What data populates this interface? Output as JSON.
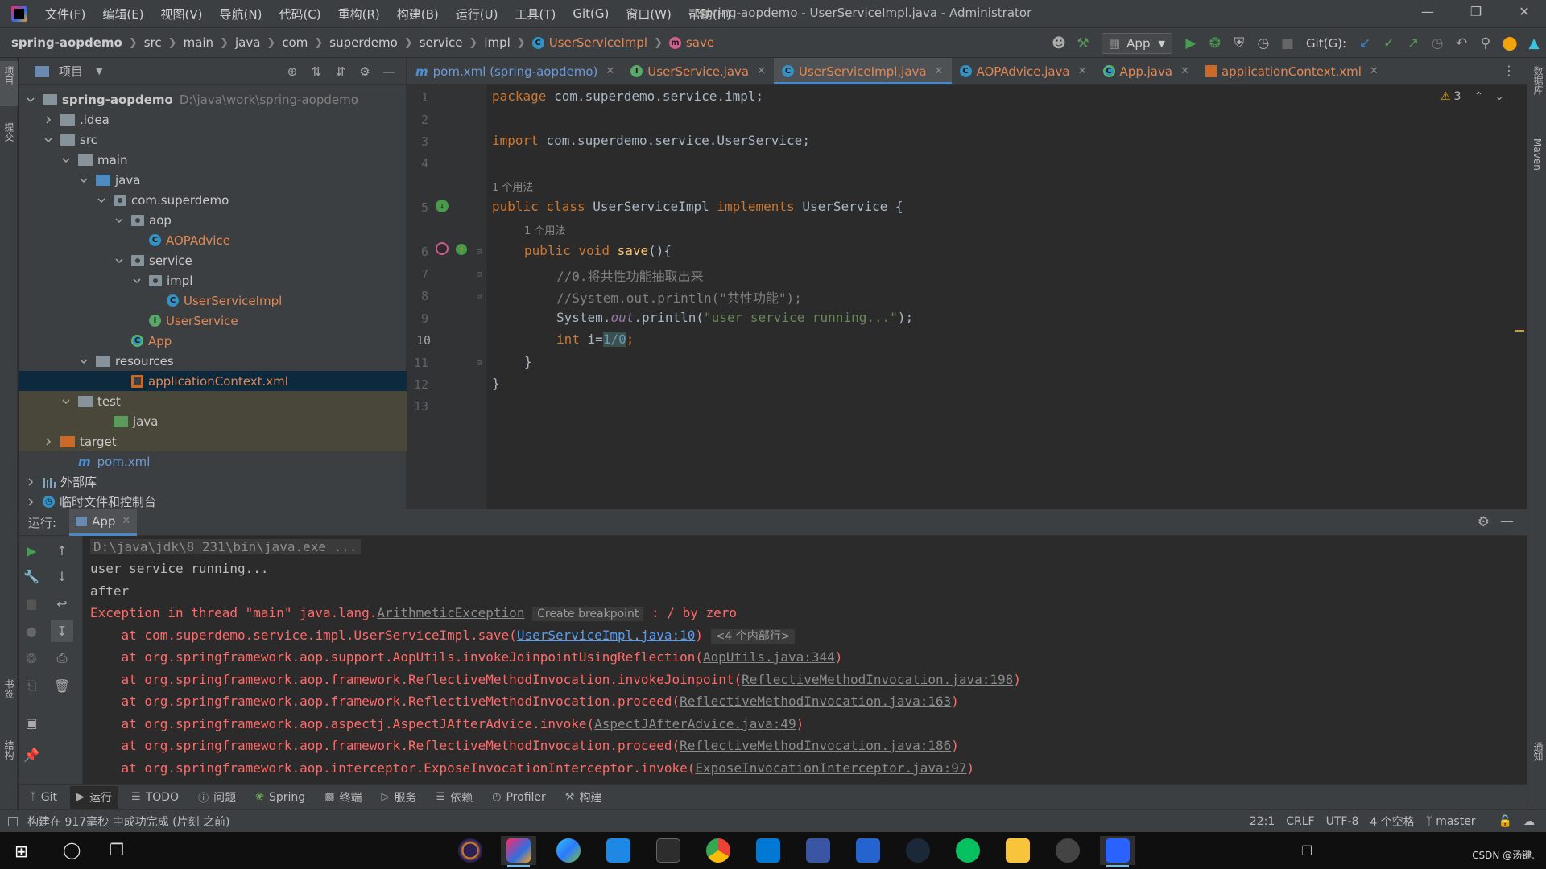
{
  "menubar": {
    "items": [
      "文件(F)",
      "编辑(E)",
      "视图(V)",
      "导航(N)",
      "代码(C)",
      "重构(R)",
      "构建(B)",
      "运行(U)",
      "工具(T)",
      "Git(G)",
      "窗口(W)",
      "帮助(H)"
    ],
    "window_title": "spring-aopdemo - UserServiceImpl.java - Administrator"
  },
  "navbar": {
    "crumbs": [
      "spring-aopdemo",
      "src",
      "main",
      "java",
      "com",
      "superdemo",
      "service",
      "impl",
      "UserServiceImpl",
      "save"
    ],
    "run_config": "App",
    "git_label": "Git(G):"
  },
  "left_stripe": {
    "project_label": "项目",
    "commit_label": "提交",
    "bookmarks_label": "书签",
    "structure_label": "结构"
  },
  "right_stripe": {
    "database_label": "数据库",
    "maven_label": "Maven",
    "notifications_label": "通知"
  },
  "project": {
    "header": "项目",
    "tree": [
      {
        "label": "spring-aopdemo",
        "hint": "D:\\java\\work\\spring-aopdemo",
        "depth": 0,
        "expanded": true,
        "icon": "module-folder"
      },
      {
        "label": ".idea",
        "depth": 1,
        "expanded": false,
        "icon": "folder"
      },
      {
        "label": "src",
        "depth": 1,
        "expanded": true,
        "icon": "folder"
      },
      {
        "label": "main",
        "depth": 2,
        "expanded": true,
        "icon": "folder"
      },
      {
        "label": "java",
        "depth": 3,
        "expanded": true,
        "icon": "source-folder"
      },
      {
        "label": "com.superdemo",
        "depth": 4,
        "expanded": true,
        "icon": "package"
      },
      {
        "label": "aop",
        "depth": 5,
        "expanded": true,
        "icon": "package"
      },
      {
        "label": "AOPAdvice",
        "depth": 6,
        "icon": "class"
      },
      {
        "label": "service",
        "depth": 5,
        "expanded": true,
        "icon": "package"
      },
      {
        "label": "impl",
        "depth": 6,
        "expanded": true,
        "icon": "package"
      },
      {
        "label": "UserServiceImpl",
        "depth": 7,
        "icon": "class"
      },
      {
        "label": "UserService",
        "depth": 6,
        "icon": "interface"
      },
      {
        "label": "App",
        "depth": 5,
        "icon": "app-class"
      },
      {
        "label": "resources",
        "depth": 3,
        "expanded": true,
        "icon": "resources-folder"
      },
      {
        "label": "applicationContext.xml",
        "depth": 5,
        "icon": "xml",
        "selected": true
      },
      {
        "label": "test",
        "depth": 2,
        "expanded": true,
        "icon": "folder"
      },
      {
        "label": "java",
        "depth": 4,
        "icon": "test-folder"
      },
      {
        "label": "target",
        "depth": 1,
        "expanded": false,
        "icon": "excluded-folder"
      },
      {
        "label": "pom.xml",
        "depth": 2,
        "icon": "maven"
      },
      {
        "label": "外部库",
        "depth": 0,
        "expanded": false,
        "icon": "library"
      },
      {
        "label": "临时文件和控制台",
        "depth": 0,
        "expanded": false,
        "icon": "scratch"
      }
    ]
  },
  "editor": {
    "tabs": [
      {
        "label": "pom.xml (spring-aopdemo)",
        "icon": "maven"
      },
      {
        "label": "UserService.java",
        "icon": "interface"
      },
      {
        "label": "UserServiceImpl.java",
        "icon": "class",
        "active": true
      },
      {
        "label": "AOPAdvice.java",
        "icon": "class"
      },
      {
        "label": "App.java",
        "icon": "app-class"
      },
      {
        "label": "applicationContext.xml",
        "icon": "xml"
      }
    ],
    "warning_count": "3",
    "line_numbers": [
      "1",
      "2",
      "3",
      "4",
      "5",
      "6",
      "7",
      "8",
      "9",
      "10",
      "11",
      "12",
      "13"
    ],
    "current_line": "10",
    "usage_hint_class": "1 个用法",
    "usage_hint_method": "1 个用法",
    "code": {
      "l1_kw": "package",
      "l1_rest": " com.superdemo.service.impl;",
      "l3_kw": "import",
      "l3_rest": " com.superdemo.service.UserService;",
      "l5_kw1": "public class",
      "l5_name": " UserServiceImpl ",
      "l5_kw2": "implements",
      "l5_rest": " UserService {",
      "l6_kw": "public void",
      "l6_fn": " save",
      "l6_rest": "(){",
      "l7": "//0.将共性功能抽取出来",
      "l8": "//System.out.println(\"共性功能\");",
      "l9_a": "System.",
      "l9_field": "out",
      "l9_b": ".println(",
      "l9_str": "\"user service running...\"",
      "l9_c": ");",
      "l10_kw": "int",
      "l10_a": " i=",
      "l10_num": "1/0",
      "l10_b": ";",
      "l11": "}",
      "l12": "}"
    }
  },
  "run": {
    "label": "运行:",
    "tab": "App",
    "lines": {
      "cmd": "D:\\java\\jdk\\8_231\\bin\\java.exe ...",
      "out1": "user service running...",
      "out2": "after",
      "exc_prefix": "Exception in thread \"main\" java.lang.",
      "exc_class": "ArithmeticException",
      "exc_bp": "Create breakpoint",
      "exc_msg": " : / by zero",
      "t1_a": "    at com.superdemo.service.impl.UserServiceImpl.save(",
      "t1_link": "UserServiceImpl.java:10",
      "t1_b": ")",
      "t1_badge": "<4 个内部行>",
      "t2_a": "    at org.springframework.aop.support.AopUtils.invokeJoinpointUsingReflection(",
      "t2_link": "AopUtils.java:344",
      "t2_b": ")",
      "t3_a": "    at org.springframework.aop.framework.ReflectiveMethodInvocation.invokeJoinpoint(",
      "t3_link": "ReflectiveMethodInvocation.java:198",
      "t3_b": ")",
      "t4_a": "    at org.springframework.aop.framework.ReflectiveMethodInvocation.proceed(",
      "t4_link": "ReflectiveMethodInvocation.java:163",
      "t4_b": ")",
      "t5_a": "    at org.springframework.aop.aspectj.AspectJAfterAdvice.invoke(",
      "t5_link": "AspectJAfterAdvice.java:49",
      "t5_b": ")",
      "t6_a": "    at org.springframework.aop.framework.ReflectiveMethodInvocation.proceed(",
      "t6_link": "ReflectiveMethodInvocation.java:186",
      "t6_b": ")",
      "t7_a": "    at org.springframework.aop.interceptor.ExposeInvocationInterceptor.invoke(",
      "t7_link": "ExposeInvocationInterceptor.java:97",
      "t7_b": ")"
    }
  },
  "tool_tabs": [
    "Git",
    "运行",
    "TODO",
    "问题",
    "Spring",
    "终端",
    "服务",
    "依赖",
    "Profiler",
    "构建"
  ],
  "status": {
    "message": "构建在 917毫秒 中成功完成 (片刻 之前)",
    "position": "22:1",
    "line_sep": "CRLF",
    "encoding": "UTF-8",
    "indent": "4 个空格",
    "branch": "master"
  },
  "taskbar": {
    "watermark": "CSDN @汤键."
  },
  "colors": {
    "accent": "#4a88c7",
    "error": "#ff6b68",
    "keyword": "#cc7832",
    "string": "#6a8759"
  }
}
